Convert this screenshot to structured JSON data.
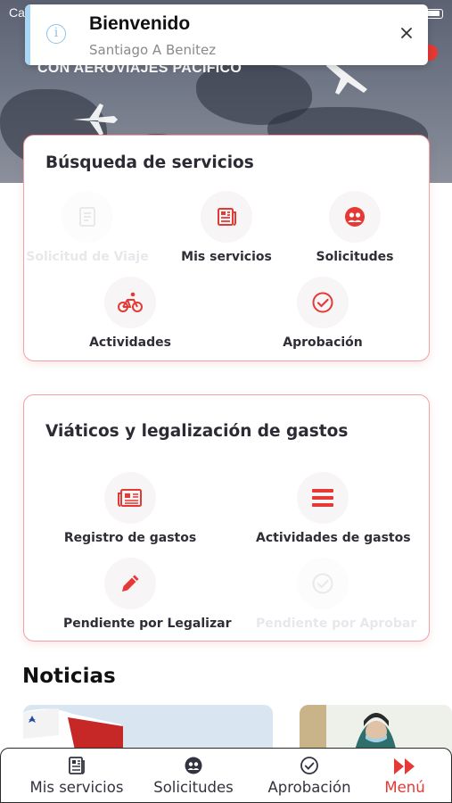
{
  "status_bar": {
    "carrier": "Car"
  },
  "hero": {
    "tagline": "CON AEROVIAJES PACIFICO"
  },
  "toast": {
    "title": "Bienvenido",
    "subtitle": "Santiago A Benitez"
  },
  "services_card": {
    "title": "Búsqueda de servicios",
    "items": [
      {
        "label": "Solicitud de Viaje",
        "icon": "document-icon",
        "enabled": false
      },
      {
        "label": "Mis servicios",
        "icon": "newspaper-icon",
        "enabled": true
      },
      {
        "label": "Solicitudes",
        "icon": "group-icon",
        "enabled": true
      },
      {
        "label": "Actividades",
        "icon": "bicycle-icon",
        "enabled": true
      },
      {
        "label": "Aprobación",
        "icon": "check-badge-icon",
        "enabled": true
      }
    ]
  },
  "expenses_card": {
    "title": "Viáticos y legalización de gastos",
    "items": [
      {
        "label": "Registro de gastos",
        "icon": "newspaper-icon",
        "enabled": true
      },
      {
        "label": "Actividades de gastos",
        "icon": "list-icon",
        "enabled": true
      },
      {
        "label": "Pendiente por Legalizar",
        "icon": "pencil-icon",
        "enabled": true
      },
      {
        "label": "Pendiente por Aprobar",
        "icon": "check-badge-icon",
        "enabled": false
      }
    ]
  },
  "news": {
    "title": "Noticias"
  },
  "tabbar": {
    "tabs": [
      {
        "label": "Mis servicios",
        "icon": "newspaper-icon"
      },
      {
        "label": "Solicitudes",
        "icon": "group-icon"
      },
      {
        "label": "Aprobación",
        "icon": "check-badge-icon"
      },
      {
        "label": "Menú",
        "icon": "fast-forward-icon",
        "active": true
      }
    ]
  },
  "colors": {
    "accent": "#e53935",
    "card_border": "#f0a2a7",
    "info": "#8cc3e8"
  }
}
